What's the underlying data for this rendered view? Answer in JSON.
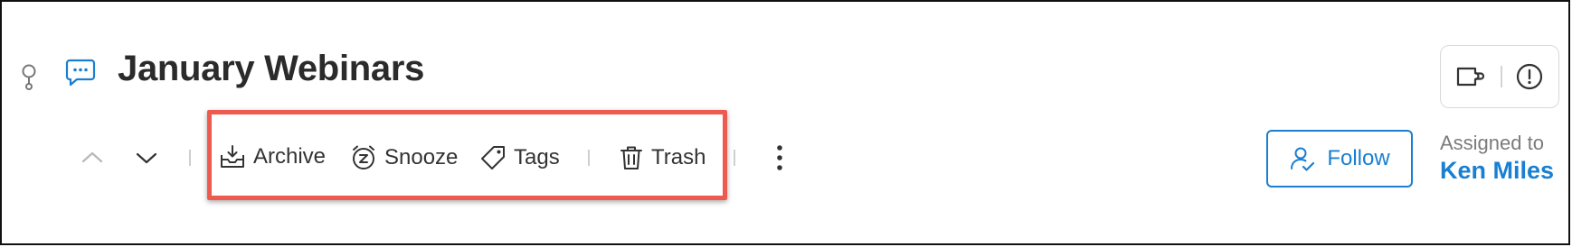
{
  "header": {
    "title": "January Webinars",
    "pin_icon": "pin-icon",
    "chat_icon": "chat-bubble-icon"
  },
  "toolbar": {
    "prev_icon": "chevron-up-icon",
    "next_icon": "chevron-down-icon",
    "archive_label": "Archive",
    "snooze_label": "Snooze",
    "tags_label": "Tags",
    "trash_label": "Trash",
    "more_icon": "more-vertical-icon"
  },
  "top_right": {
    "integration_icon": "puzzle-icon",
    "alert_icon": "alert-circle-icon"
  },
  "assignment": {
    "follow_label": "Follow",
    "assigned_label": "Assigned to",
    "assignee_name": "Ken Miles"
  },
  "colors": {
    "accent": "#1a7fd1",
    "highlight": "#ef5a4f",
    "text": "#2b2b2b",
    "muted": "#7b7b7b"
  }
}
